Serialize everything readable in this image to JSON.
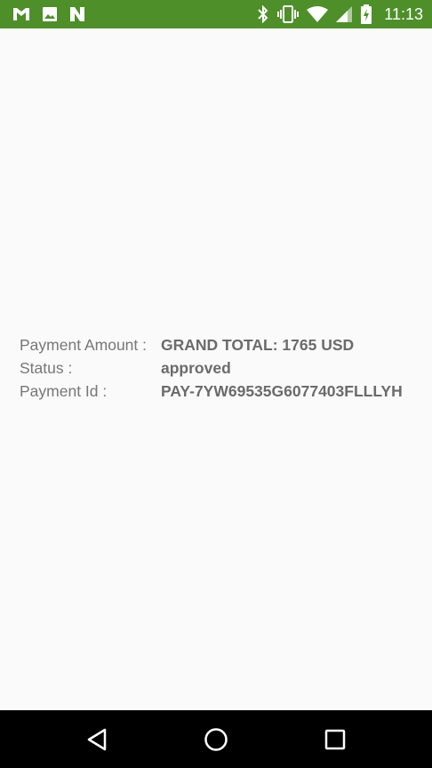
{
  "status_bar": {
    "time": "11:13",
    "background_color": "#4e8f2a",
    "left_icons": [
      "gmail-icon",
      "image-icon",
      "n-app-icon"
    ],
    "right_icons": [
      "bluetooth-icon",
      "vibrate-icon",
      "wifi-icon",
      "cell-signal-icon",
      "battery-charging-icon"
    ]
  },
  "payment": {
    "amount_label": "Payment Amount :",
    "amount_value": "GRAND TOTAL: 1765 USD",
    "status_label": "Status :",
    "status_value": "approved",
    "id_label": "Payment Id :",
    "id_value": "PAY-7YW69535G6077403FLLLYH"
  },
  "nav_bar": {
    "buttons": [
      "back-icon",
      "home-icon",
      "recents-icon"
    ]
  }
}
